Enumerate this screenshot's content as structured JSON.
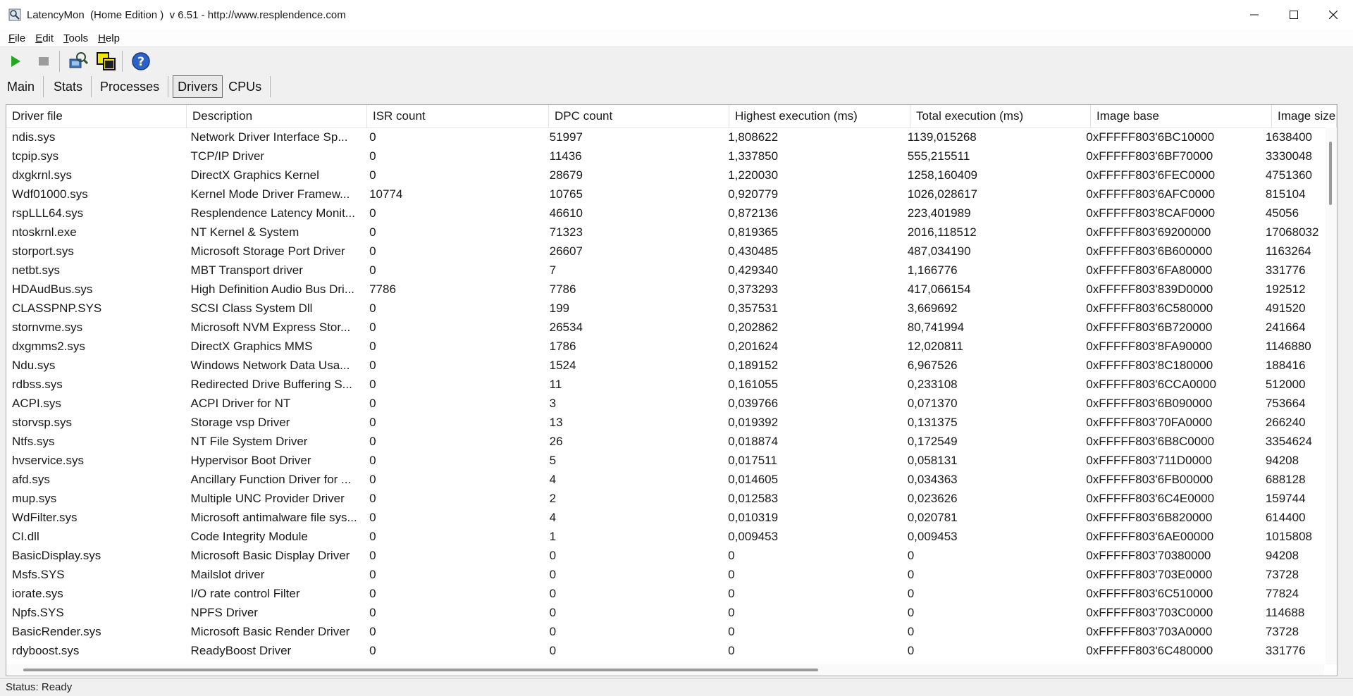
{
  "window": {
    "title": "LatencyMon  (Home Edition )  v 6.51 - http://www.resplendence.com"
  },
  "menu": [
    {
      "accel": "F",
      "rest": "ile"
    },
    {
      "accel": "E",
      "rest": "dit"
    },
    {
      "accel": "T",
      "rest": "ools"
    },
    {
      "accel": "H",
      "rest": "elp"
    }
  ],
  "toolbar": {
    "icons": [
      "play-icon",
      "stop-icon",
      "drivers-analyze-icon",
      "windows-icon",
      "help-icon"
    ]
  },
  "tabs": [
    "Main",
    "Stats",
    "Processes",
    "Drivers",
    "CPUs"
  ],
  "active_tab": "Drivers",
  "table": {
    "columns": [
      "Driver file",
      "Description",
      "ISR count",
      "DPC count",
      "Highest execution (ms)",
      "Total execution (ms)",
      "Image base",
      "Image size"
    ],
    "rows": [
      [
        "ndis.sys",
        "Network Driver Interface Sp...",
        "0",
        "51997",
        "1,808622",
        "1139,015268",
        "0xFFFFF803'6BC10000",
        "1638400"
      ],
      [
        "tcpip.sys",
        "TCP/IP Driver",
        "0",
        "11436",
        "1,337850",
        "555,215511",
        "0xFFFFF803'6BF70000",
        "3330048"
      ],
      [
        "dxgkrnl.sys",
        "DirectX Graphics Kernel",
        "0",
        "28679",
        "1,220030",
        "1258,160409",
        "0xFFFFF803'6FEC0000",
        "4751360"
      ],
      [
        "Wdf01000.sys",
        "Kernel Mode Driver Framew...",
        "10774",
        "10765",
        "0,920779",
        "1026,028617",
        "0xFFFFF803'6AFC0000",
        "815104"
      ],
      [
        "rspLLL64.sys",
        "Resplendence Latency Monit...",
        "0",
        "46610",
        "0,872136",
        "223,401989",
        "0xFFFFF803'8CAF0000",
        "45056"
      ],
      [
        "ntoskrnl.exe",
        "NT Kernel & System",
        "0",
        "71323",
        "0,819365",
        "2016,118512",
        "0xFFFFF803'69200000",
        "17068032"
      ],
      [
        "storport.sys",
        "Microsoft Storage Port Driver",
        "0",
        "26607",
        "0,430485",
        "487,034190",
        "0xFFFFF803'6B600000",
        "1163264"
      ],
      [
        "netbt.sys",
        "MBT Transport driver",
        "0",
        "7",
        "0,429340",
        "1,166776",
        "0xFFFFF803'6FA80000",
        "331776"
      ],
      [
        "HDAudBus.sys",
        "High Definition Audio Bus Dri...",
        "7786",
        "7786",
        "0,373293",
        "417,066154",
        "0xFFFFF803'839D0000",
        "192512"
      ],
      [
        "CLASSPNP.SYS",
        "SCSI Class System Dll",
        "0",
        "199",
        "0,357531",
        "3,669692",
        "0xFFFFF803'6C580000",
        "491520"
      ],
      [
        "stornvme.sys",
        "Microsoft NVM Express Stor...",
        "0",
        "26534",
        "0,202862",
        "80,741994",
        "0xFFFFF803'6B720000",
        "241664"
      ],
      [
        "dxgmms2.sys",
        "DirectX Graphics MMS",
        "0",
        "1786",
        "0,201624",
        "12,020811",
        "0xFFFFF803'8FA90000",
        "1146880"
      ],
      [
        "Ndu.sys",
        "Windows Network Data Usa...",
        "0",
        "1524",
        "0,189152",
        "6,967526",
        "0xFFFFF803'8C180000",
        "188416"
      ],
      [
        "rdbss.sys",
        "Redirected Drive Buffering S...",
        "0",
        "11",
        "0,161055",
        "0,233108",
        "0xFFFFF803'6CCA0000",
        "512000"
      ],
      [
        "ACPI.sys",
        "ACPI Driver for NT",
        "0",
        "3",
        "0,039766",
        "0,071370",
        "0xFFFFF803'6B090000",
        "753664"
      ],
      [
        "storvsp.sys",
        "Storage vsp Driver",
        "0",
        "13",
        "0,019392",
        "0,131375",
        "0xFFFFF803'70FA0000",
        "266240"
      ],
      [
        "Ntfs.sys",
        "NT File System Driver",
        "0",
        "26",
        "0,018874",
        "0,172549",
        "0xFFFFF803'6B8C0000",
        "3354624"
      ],
      [
        "hvservice.sys",
        "Hypervisor Boot Driver",
        "0",
        "5",
        "0,017511",
        "0,058131",
        "0xFFFFF803'711D0000",
        "94208"
      ],
      [
        "afd.sys",
        "Ancillary Function Driver for ...",
        "0",
        "4",
        "0,014605",
        "0,034363",
        "0xFFFFF803'6FB00000",
        "688128"
      ],
      [
        "mup.sys",
        "Multiple UNC Provider Driver",
        "0",
        "2",
        "0,012583",
        "0,023626",
        "0xFFFFF803'6C4E0000",
        "159744"
      ],
      [
        "WdFilter.sys",
        "Microsoft antimalware file sys...",
        "0",
        "4",
        "0,010319",
        "0,020781",
        "0xFFFFF803'6B820000",
        "614400"
      ],
      [
        "CI.dll",
        "Code Integrity Module",
        "0",
        "1",
        "0,009453",
        "0,009453",
        "0xFFFFF803'6AE00000",
        "1015808"
      ],
      [
        "BasicDisplay.sys",
        "Microsoft Basic Display Driver",
        "0",
        "0",
        "0",
        "0",
        "0xFFFFF803'70380000",
        "94208"
      ],
      [
        "Msfs.SYS",
        "Mailslot driver",
        "0",
        "0",
        "0",
        "0",
        "0xFFFFF803'703E0000",
        "73728"
      ],
      [
        "iorate.sys",
        "I/O rate control Filter",
        "0",
        "0",
        "0",
        "0",
        "0xFFFFF803'6C510000",
        "77824"
      ],
      [
        "Npfs.SYS",
        "NPFS Driver",
        "0",
        "0",
        "0",
        "0",
        "0xFFFFF803'703C0000",
        "114688"
      ],
      [
        "BasicRender.sys",
        "Microsoft Basic Render Driver",
        "0",
        "0",
        "0",
        "0",
        "0xFFFFF803'703A0000",
        "73728"
      ],
      [
        "rdyboost.sys",
        "ReadyBoost Driver",
        "0",
        "0",
        "0",
        "0",
        "0xFFFFF803'6C480000",
        "331776"
      ]
    ]
  },
  "status": "Status: Ready"
}
